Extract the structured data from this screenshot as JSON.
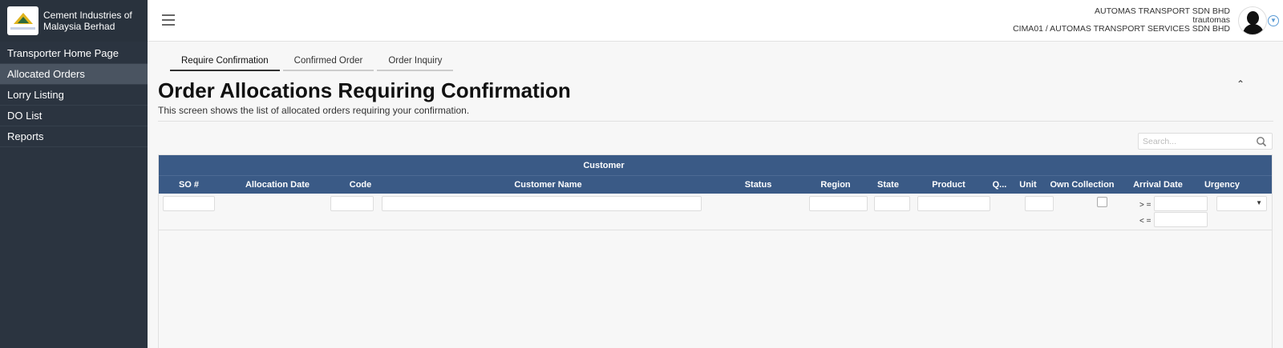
{
  "brand": {
    "name": "Cement Industries of Malaysia Berhad"
  },
  "nav": {
    "items": [
      {
        "label": "Transporter Home Page"
      },
      {
        "label": "Allocated Orders",
        "active": true
      },
      {
        "label": "Lorry Listing"
      },
      {
        "label": "DO List"
      },
      {
        "label": "Reports"
      }
    ]
  },
  "user": {
    "company": "AUTOMAS TRANSPORT SDN BHD",
    "username": "trautomas",
    "account": "CIMA01 / AUTOMAS TRANSPORT SERVICES SDN BHD"
  },
  "tabs": [
    {
      "label": "Require Confirmation",
      "active": true
    },
    {
      "label": "Confirmed Order"
    },
    {
      "label": "Order Inquiry"
    }
  ],
  "page": {
    "title": "Order Allocations Requiring Confirmation",
    "description": "This screen shows the list of allocated orders requiring your confirmation."
  },
  "search": {
    "placeholder": "Search..."
  },
  "grid": {
    "group_header": "Customer",
    "columns": [
      "SO #",
      "Allocation Date",
      "Code",
      "Customer Name",
      "Status",
      "Region",
      "State",
      "Product",
      "Q...",
      "Unit",
      "Own Collection",
      "Arrival Date",
      "Urgency"
    ],
    "filters": {
      "arrival_from_label": "> =",
      "arrival_to_label": "< ="
    }
  },
  "icons": {
    "menu": "hamburger-icon",
    "search": "search-icon",
    "collapse": "chevron-up-icon",
    "user_menu": "chevron-down-icon",
    "avatar": "avatar-icon"
  },
  "colors": {
    "sidebar": "#2b3440",
    "grid_header": "#3a5a86",
    "accent": "#5b9bd5"
  }
}
